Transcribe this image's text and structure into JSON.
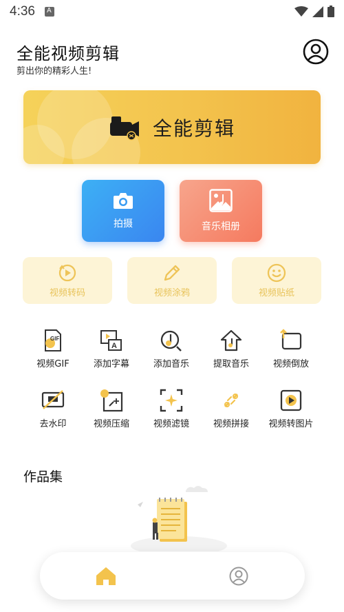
{
  "status_bar": {
    "time": "4:36"
  },
  "header": {
    "title": "全能视频剪辑",
    "subtitle": "剪出你的精彩人生!"
  },
  "hero": {
    "label": "全能剪辑"
  },
  "primary_actions": [
    {
      "label": "拍摄",
      "icon": "camera-icon"
    },
    {
      "label": "音乐相册",
      "icon": "music-album-icon"
    }
  ],
  "secondary_actions": [
    {
      "label": "视频转码",
      "icon": "transcode-icon"
    },
    {
      "label": "视频涂鸦",
      "icon": "pencil-icon"
    },
    {
      "label": "视频贴纸",
      "icon": "smiley-icon"
    }
  ],
  "tools": [
    {
      "label": "视频GIF",
      "icon": "gif-icon"
    },
    {
      "label": "添加字幕",
      "icon": "subtitle-icon"
    },
    {
      "label": "添加音乐",
      "icon": "add-music-icon"
    },
    {
      "label": "提取音乐",
      "icon": "extract-music-icon"
    },
    {
      "label": "视频倒放",
      "icon": "reverse-icon"
    },
    {
      "label": "去水印",
      "icon": "watermark-icon"
    },
    {
      "label": "视频压缩",
      "icon": "compress-icon"
    },
    {
      "label": "视频滤镜",
      "icon": "filter-icon"
    },
    {
      "label": "视频拼接",
      "icon": "splice-icon"
    },
    {
      "label": "视频转图片",
      "icon": "video-to-image-icon"
    }
  ],
  "works": {
    "title": "作品集"
  },
  "nav": {
    "active": "home"
  },
  "colors": {
    "accent": "#f3c34d",
    "blue": "#3a86f0",
    "coral": "#f57a5f",
    "soft": "#fdf4d6",
    "soft_text": "#e8c35a"
  }
}
